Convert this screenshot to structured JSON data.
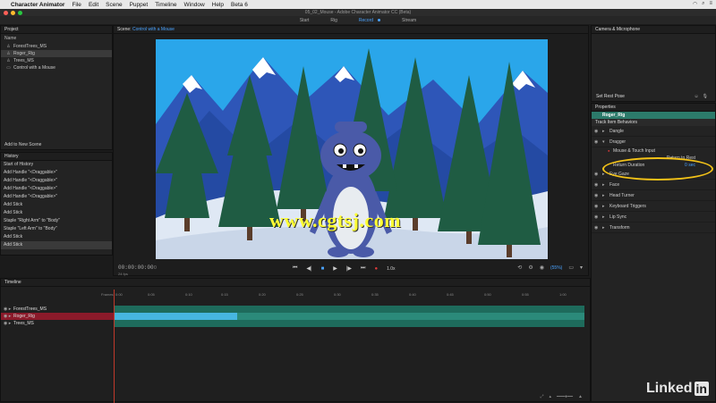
{
  "menubar": {
    "apple": "",
    "app": "Character Animator",
    "items": [
      "File",
      "Edit",
      "Scene",
      "Puppet",
      "Timeline",
      "Window",
      "Help",
      "Beta 6"
    ]
  },
  "window_title": "05_02_Mouse - Adobe Character Animator CC (Beta)",
  "modes": [
    "Start",
    "Rig",
    "Record",
    "Stream"
  ],
  "active_mode": "Record",
  "project": {
    "title": "Project",
    "col_name": "Name",
    "items": [
      {
        "label": "ForestTrees_MS",
        "icon": "puppet-icon"
      },
      {
        "label": "Roger_Rig",
        "icon": "puppet-icon"
      },
      {
        "label": "Trees_MS",
        "icon": "puppet-icon"
      },
      {
        "label": "Control with a Mouse",
        "icon": "scene-icon"
      }
    ],
    "add_scene": "Add to New Scene"
  },
  "history": {
    "title": "History",
    "items": [
      "Start of History",
      "Add Handle \"<Draggable>\"",
      "Add Handle \"<Draggable>\"",
      "Add Handle \"<Draggable>\"",
      "Add Handle \"<Draggable>\"",
      "Add Stick",
      "Add Stick",
      "Staple \"Right Arm\" to \"Body\"",
      "Staple \"Left Arm\" to \"Body\"",
      "Add Stick",
      "Add Stick"
    ]
  },
  "scene": {
    "title_prefix": "Scene:",
    "title_name": "Control with a Mouse",
    "timecode": "00:00:00:00",
    "timecode_sub": "0",
    "fps": "24 fps",
    "speed": "1.0x",
    "zoom": "(55%)"
  },
  "watermark": "www.cgtsj.com",
  "camera": {
    "title": "Camera & Microphone",
    "set_rest_pose": "Set Rest Pose"
  },
  "properties": {
    "title": "Properties",
    "rig": "Roger_Rig",
    "section": "Track Item Behaviors",
    "behaviors": [
      "Dangle",
      "Dragger",
      "Eye Gaze",
      "Face",
      "Head Turner",
      "Keyboard Triggers",
      "Lip Sync",
      "Transform"
    ],
    "dragger_input": "Mouse & Touch Input",
    "return_rest_label": "Return to Rest",
    "return_duration_label": "Return Duration",
    "return_duration_value": "0 sec"
  },
  "timeline": {
    "title": "Timeline",
    "ruler_labels": [
      "Frames",
      "0:00",
      "24",
      "0:05",
      "0:10",
      "0:15",
      "0:20",
      "0:25",
      "0:30",
      "0:35",
      "0:40",
      "0:45",
      "0:50",
      "0:55",
      "1:00"
    ],
    "tracks": [
      "ForestTrees_MS",
      "Roger_Rig",
      "Trees_MS"
    ]
  },
  "logo": {
    "text": "Linked",
    "in": "in"
  }
}
